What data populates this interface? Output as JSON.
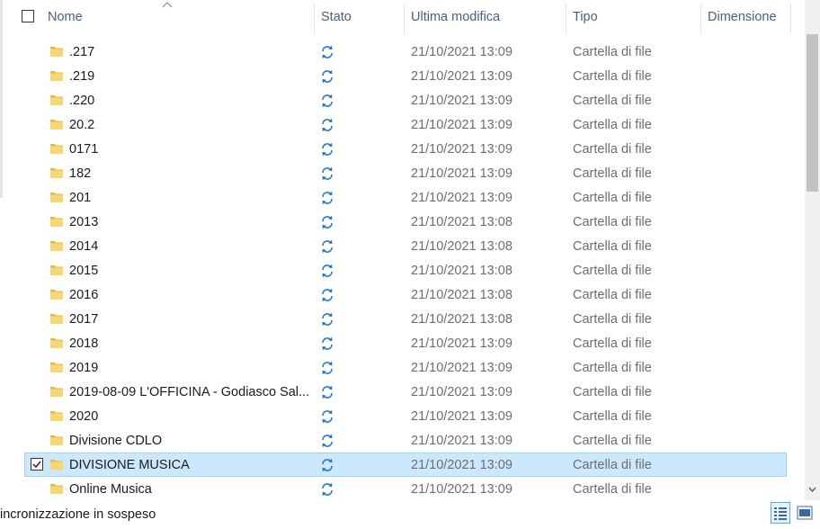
{
  "header": {
    "name_label": "Nome",
    "status_label": "Stato",
    "modified_label": "Ultima modifica",
    "type_label": "Tipo",
    "size_label": "Dimensione"
  },
  "rows": [
    {
      "name": ".217",
      "date": "21/10/2021 13:09",
      "type": "Cartella di file",
      "selected": false
    },
    {
      "name": ".219",
      "date": "21/10/2021 13:09",
      "type": "Cartella di file",
      "selected": false
    },
    {
      "name": ".220",
      "date": "21/10/2021 13:09",
      "type": "Cartella di file",
      "selected": false
    },
    {
      "name": "20.2",
      "date": "21/10/2021 13:09",
      "type": "Cartella di file",
      "selected": false
    },
    {
      "name": "0171",
      "date": "21/10/2021 13:09",
      "type": "Cartella di file",
      "selected": false
    },
    {
      "name": "182",
      "date": "21/10/2021 13:09",
      "type": "Cartella di file",
      "selected": false
    },
    {
      "name": "201",
      "date": "21/10/2021 13:09",
      "type": "Cartella di file",
      "selected": false
    },
    {
      "name": "2013",
      "date": "21/10/2021 13:08",
      "type": "Cartella di file",
      "selected": false
    },
    {
      "name": "2014",
      "date": "21/10/2021 13:08",
      "type": "Cartella di file",
      "selected": false
    },
    {
      "name": "2015",
      "date": "21/10/2021 13:08",
      "type": "Cartella di file",
      "selected": false
    },
    {
      "name": "2016",
      "date": "21/10/2021 13:08",
      "type": "Cartella di file",
      "selected": false
    },
    {
      "name": "2017",
      "date": "21/10/2021 13:08",
      "type": "Cartella di file",
      "selected": false
    },
    {
      "name": "2018",
      "date": "21/10/2021 13:09",
      "type": "Cartella di file",
      "selected": false
    },
    {
      "name": "2019",
      "date": "21/10/2021 13:09",
      "type": "Cartella di file",
      "selected": false
    },
    {
      "name": "2019-08-09 L'OFFICINA - Godiasco Sal...",
      "date": "21/10/2021 13:09",
      "type": "Cartella di file",
      "selected": false
    },
    {
      "name": "2020",
      "date": "21/10/2021 13:09",
      "type": "Cartella di file",
      "selected": false
    },
    {
      "name": "Divisione CDLO",
      "date": "21/10/2021 13:09",
      "type": "Cartella di file",
      "selected": false
    },
    {
      "name": "DIVISIONE MUSICA",
      "date": "21/10/2021 13:09",
      "type": "Cartella di file",
      "selected": true
    },
    {
      "name": "Online Musica",
      "date": "21/10/2021 13:09",
      "type": "Cartella di file",
      "selected": false
    }
  ],
  "status_icon": "sync-pending-icon",
  "folder_icon": "folder-icon",
  "colors": {
    "sync_icon": "#1a73c9",
    "folder_yellow": "#f7d774",
    "selected_bg": "#cce8ff",
    "selected_border": "#99d1ff",
    "header_text": "#4c607a"
  },
  "statusbar": {
    "text": "incronizzazione in sospeso"
  }
}
